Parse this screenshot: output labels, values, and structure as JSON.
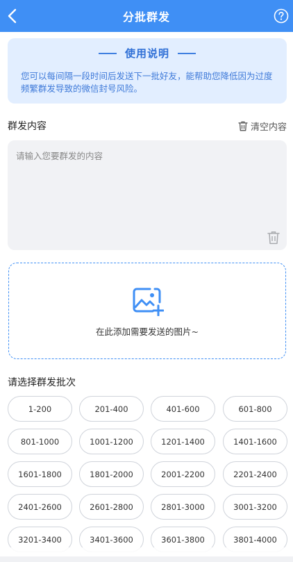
{
  "header": {
    "title": "分批群发",
    "bg_color": "#3f8ff5"
  },
  "notice": {
    "title": "使用说明",
    "text": "您可以每间隔一段时间后发送下一批好友，能帮助您降低因为过度频繁群发导致的微信封号风险。"
  },
  "content_section": {
    "title": "群发内容",
    "clear_label": "清空内容",
    "placeholder": "请输入您要群发的内容",
    "value": ""
  },
  "upload": {
    "label": "在此添加需要发送的图片~",
    "icon": "add-image-icon"
  },
  "batch": {
    "title": "请选择群发批次",
    "options": [
      "1-200",
      "201-400",
      "401-600",
      "601-800",
      "801-1000",
      "1001-1200",
      "1201-1400",
      "1401-1600",
      "1601-1800",
      "1801-2000",
      "2001-2200",
      "2201-2400",
      "2401-2600",
      "2601-2800",
      "2801-3000",
      "3001-3200",
      "3201-3400",
      "3401-3600",
      "3601-3800",
      "3801-4000"
    ]
  }
}
